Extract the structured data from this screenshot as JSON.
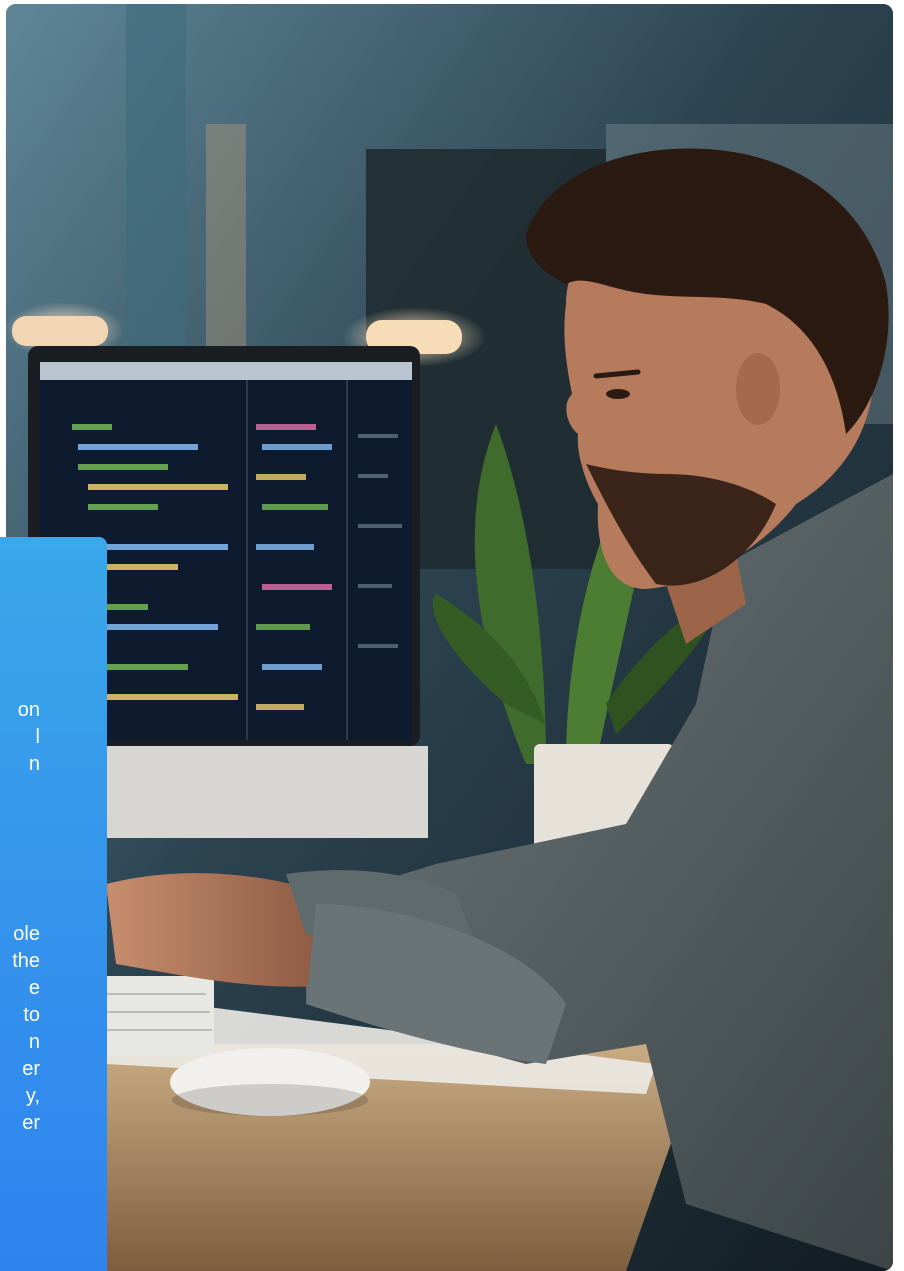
{
  "photo": {
    "subject": "man-at-computer",
    "palette": {
      "background": "#1b2a33",
      "skin": "#b67a5c",
      "hair": "#2a1a12",
      "shirt": "#5b6568",
      "desk": "#a98a66",
      "screen": "#0e1b2e",
      "plant": "#3f6b2c"
    }
  },
  "card": {
    "accent": "#3596ec",
    "paragraph_1": [
      "on",
      "l",
      "n"
    ],
    "paragraph_2": [
      "ole",
      "the",
      "e",
      "to",
      "n",
      "er",
      "y,",
      "er"
    ]
  }
}
